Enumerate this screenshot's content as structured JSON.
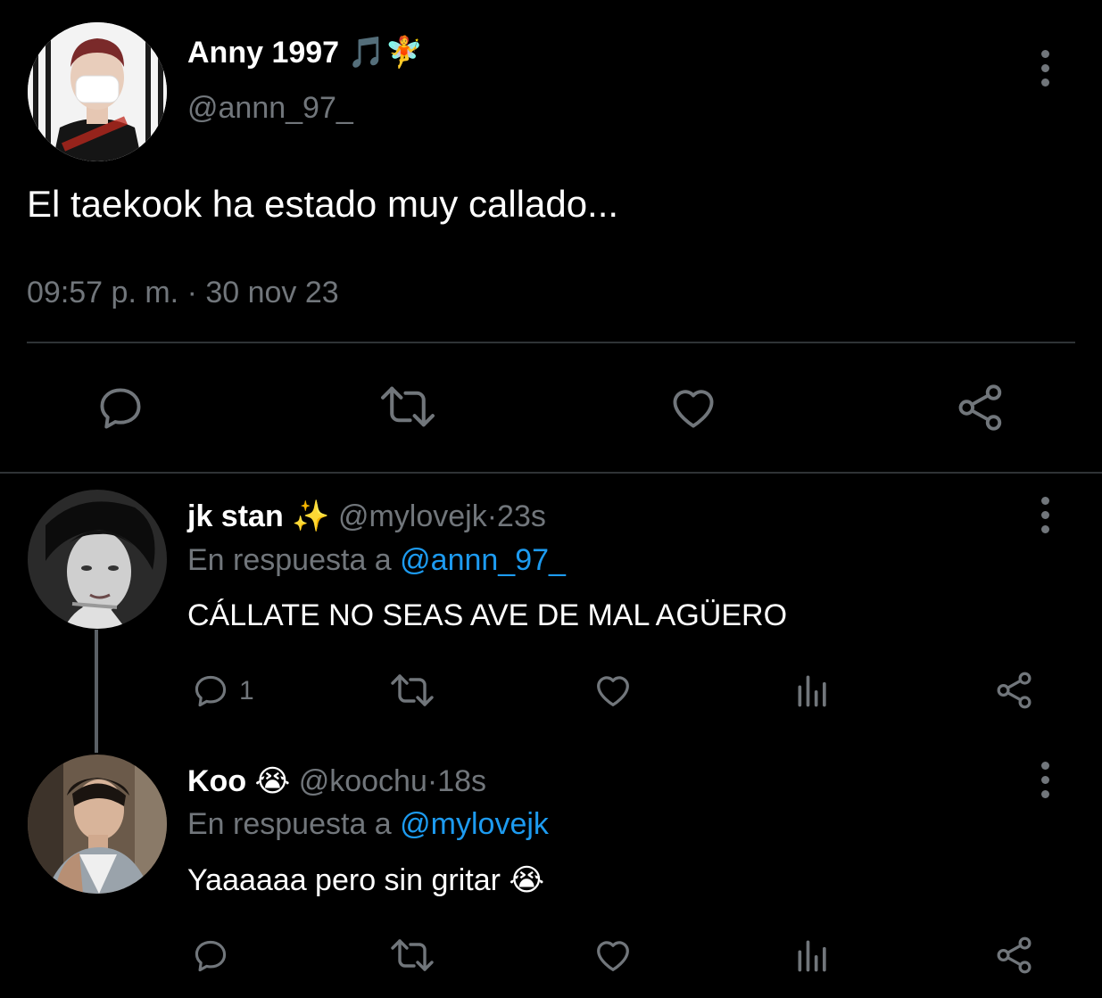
{
  "main_tweet": {
    "author_name": "Anny 1997 🎵🧚",
    "handle": "@annn_97_",
    "text": "El taekook ha estado muy callado...",
    "time": "09:57 p. m.",
    "separator": "·",
    "date": "30 nov 23"
  },
  "replies": [
    {
      "name": "jk stan ✨",
      "handle": "@mylovejk",
      "dot": "·",
      "time": "23s",
      "reply_to_label": "En respuesta a",
      "reply_to_mention": "@annn_97_",
      "text": "CÁLLATE NO SEAS AVE DE MAL AGÜERO",
      "reply_count": "1"
    },
    {
      "name": "Koo 😭",
      "handle": "@koochu",
      "dot": "·",
      "time": "18s",
      "reply_to_label": "En respuesta a",
      "reply_to_mention": "@mylovejk",
      "text": "Yaaaaaa pero sin gritar 😭",
      "reply_count": ""
    }
  ],
  "icons": {
    "reply": "comment-bubble-icon",
    "retweet": "retweet-icon",
    "like": "heart-icon",
    "views": "bar-chart-icon",
    "share": "share-icon",
    "more": "more-vertical-icon"
  },
  "colors": {
    "background": "#000000",
    "primary_text": "#ffffff",
    "secondary_text": "#71767b",
    "mention": "#1d9bf0",
    "divider": "#2f3336"
  }
}
